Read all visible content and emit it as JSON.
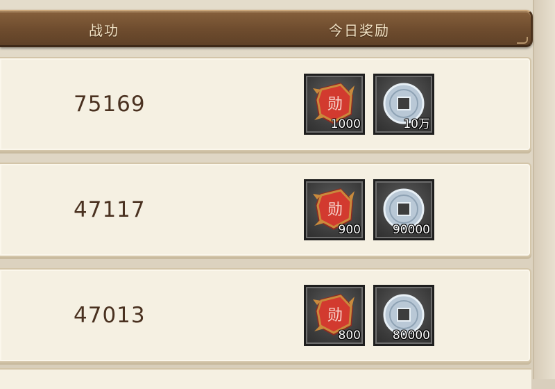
{
  "header": {
    "score_label": "战功",
    "reward_label": "今日奖励"
  },
  "rows": [
    {
      "score": "75169",
      "rewards": [
        {
          "icon": "battle-merit-medal-icon",
          "quantity": "1000"
        },
        {
          "icon": "copper-coin-icon",
          "quantity": "10万"
        }
      ]
    },
    {
      "score": "47117",
      "rewards": [
        {
          "icon": "battle-merit-medal-icon",
          "quantity": "900"
        },
        {
          "icon": "copper-coin-icon",
          "quantity": "90000"
        }
      ]
    },
    {
      "score": "47013",
      "rewards": [
        {
          "icon": "battle-merit-medal-icon",
          "quantity": "800"
        },
        {
          "icon": "copper-coin-icon",
          "quantity": "80000"
        }
      ]
    }
  ],
  "medal_glyph": "勋",
  "colors": {
    "header_bg": "#6e4c2e",
    "row_bg": "#f5f0e2",
    "score_text": "#4a3120",
    "medal_red": "#d23a2f",
    "medal_gold": "#c98a3c",
    "coin_silver": "#b9c8d6"
  }
}
